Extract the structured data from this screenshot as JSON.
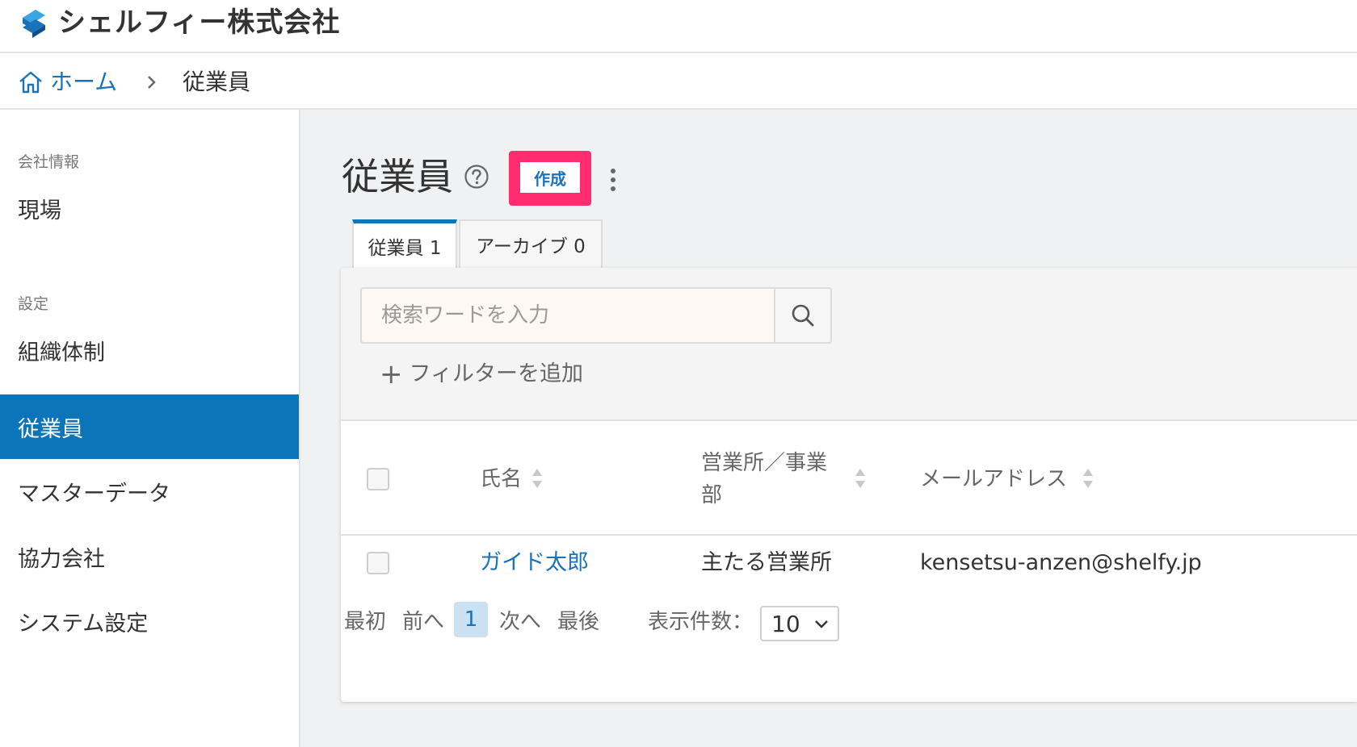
{
  "header": {
    "company_name": "シェルフィー株式会社",
    "logo_icon": "shelfy-logo-icon"
  },
  "breadcrumb": {
    "home_label": "ホーム",
    "separator_icon": "chevron-right-icon",
    "current": "従業員"
  },
  "sidebar": {
    "sections": [
      {
        "title": "会社情報",
        "items": [
          {
            "label": "現場",
            "active": false
          }
        ]
      },
      {
        "title": "設定",
        "items": [
          {
            "label": "組織体制",
            "active": false
          },
          {
            "label": "従業員",
            "active": true
          },
          {
            "label": "マスターデータ",
            "active": false
          },
          {
            "label": "協力会社",
            "active": false
          },
          {
            "label": "システム設定",
            "active": false
          }
        ]
      }
    ]
  },
  "page": {
    "title": "従業員",
    "create_label": "作成",
    "tabs": [
      {
        "label": "従業員 1",
        "active": true
      },
      {
        "label": "アーカイブ 0",
        "active": false
      }
    ],
    "search": {
      "placeholder": "検索ワードを入力"
    },
    "add_filter_label": "フィルターを追加",
    "table": {
      "columns": [
        "氏名",
        "営業所／事業部",
        "メールアドレス"
      ],
      "rows": [
        {
          "name": "ガイド太郎",
          "office": "主たる営業所",
          "email": "kensetsu-anzen@shelfy.jp"
        }
      ]
    },
    "pagination": {
      "first": "最初",
      "prev": "前へ",
      "current": "1",
      "next": "次へ",
      "last": "最後",
      "per_page_label": "表示件数：",
      "per_page_value": "10"
    }
  },
  "colors": {
    "accent": "#0c74b8",
    "highlight": "#ff2d6f",
    "link": "#1a73b8"
  }
}
